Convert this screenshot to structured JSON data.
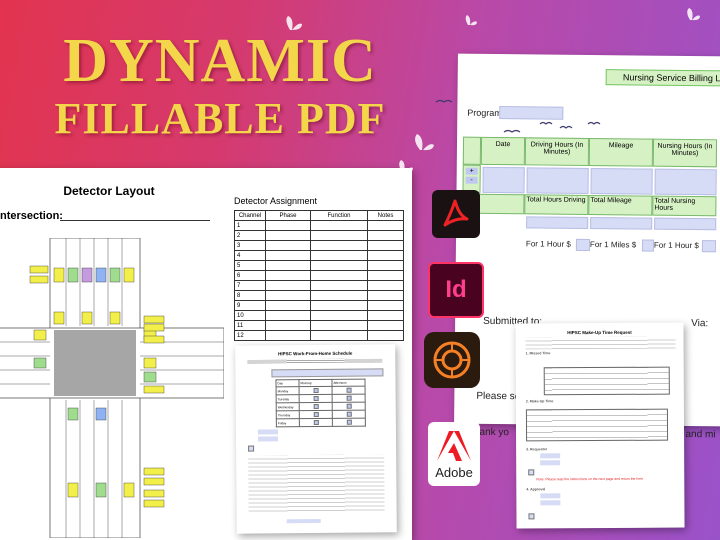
{
  "hero": {
    "line1": "DYNAMIC",
    "line2": "FILLABLE PDF"
  },
  "detector": {
    "title": "Detector Layout",
    "intersection_label": "ntersection:",
    "assignment_title": "Detector Assignment",
    "columns": [
      "Channel",
      "Phase",
      "Function",
      "Notes"
    ],
    "channels": [
      "1",
      "2",
      "3",
      "4",
      "5",
      "6",
      "7",
      "8",
      "9",
      "10",
      "11",
      "12"
    ]
  },
  "billing": {
    "title": "Nursing Service Billing L",
    "program_label": "Program:",
    "headers": [
      "Date",
      "Driving Hours (In Minutes)",
      "Mileage",
      "Nursing Hours (In Minutes)"
    ],
    "totals": [
      "Total Hours Driving",
      "Total Mileage",
      "Total Nursing Hours"
    ],
    "rates": [
      "For 1 Hour $",
      "For 1 Miles $",
      "For 1 Hour $"
    ],
    "plus": "+",
    "minus": "-",
    "submitted": "Submitted to:",
    "via": "Via:",
    "please": "Please se",
    "thank": "hank yo",
    "tmi": "t and mi"
  },
  "wfh": {
    "title": "HIPSC Work-From-Home Schedule",
    "days": [
      "Monday",
      "Tuesday",
      "Wednesday",
      "Thursday",
      "Friday"
    ],
    "cols": [
      "Day",
      "Morning",
      "Afternoon"
    ]
  },
  "makeup": {
    "title": "HIPSC Make-Up Time Request",
    "sections": [
      "1. Missed Time",
      "2. Make-Up Time",
      "3. Requester",
      "4. Approval"
    ],
    "note": "Note: Please read the instructions on the next page and return the form"
  },
  "apps": {
    "adobe_label": "Adobe",
    "id_label": "Id"
  },
  "colors": {
    "acrobat": "#ed2224",
    "indesign": "#49021f",
    "experience": "#f58025",
    "adobe": "#ed1c24",
    "gold": "#f3d64a"
  }
}
